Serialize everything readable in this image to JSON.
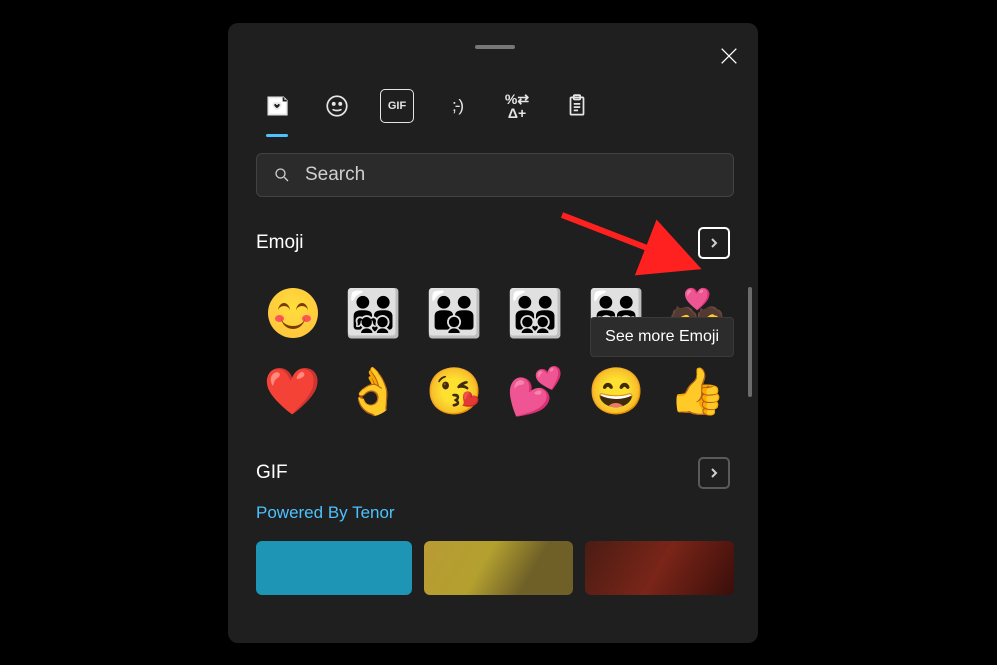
{
  "tabs": {
    "recent": "recent",
    "emoji": "emoji",
    "gif_label": "GIF",
    "kaomoji_label": ";-)",
    "symbols_label": "%⇄\nΔ+",
    "clipboard": "clipboard"
  },
  "search": {
    "placeholder": "Search",
    "value": ""
  },
  "emoji_section": {
    "title": "Emoji",
    "tooltip": "See more Emoji",
    "items": [
      {
        "name": "smiling-face-blushing",
        "glyph": ""
      },
      {
        "name": "family-man-man-girl-boy",
        "glyph": "👨‍👨‍👧‍👦"
      },
      {
        "name": "family-man-man-boy",
        "glyph": "👨‍👨‍👦"
      },
      {
        "name": "family-man-man-boy-boy",
        "glyph": "👨‍👨‍👦‍👦"
      },
      {
        "name": "family-man-man-girl-girl",
        "glyph": "👨‍👨‍👧‍👧"
      },
      {
        "name": "couple-with-heart",
        "glyph": "💑"
      },
      {
        "name": "red-heart",
        "glyph": "❤️"
      },
      {
        "name": "ok-hand",
        "glyph": "👌"
      },
      {
        "name": "face-blowing-kiss",
        "glyph": "😘"
      },
      {
        "name": "two-hearts",
        "glyph": "💕"
      },
      {
        "name": "beaming-face",
        "glyph": "😄"
      },
      {
        "name": "thumbs-up",
        "glyph": "👍"
      }
    ]
  },
  "gif_section": {
    "title": "GIF",
    "powered": "Powered By Tenor"
  },
  "annotation": {
    "type": "arrow",
    "color": "#ff2020",
    "target": "emoji-expand-button"
  }
}
